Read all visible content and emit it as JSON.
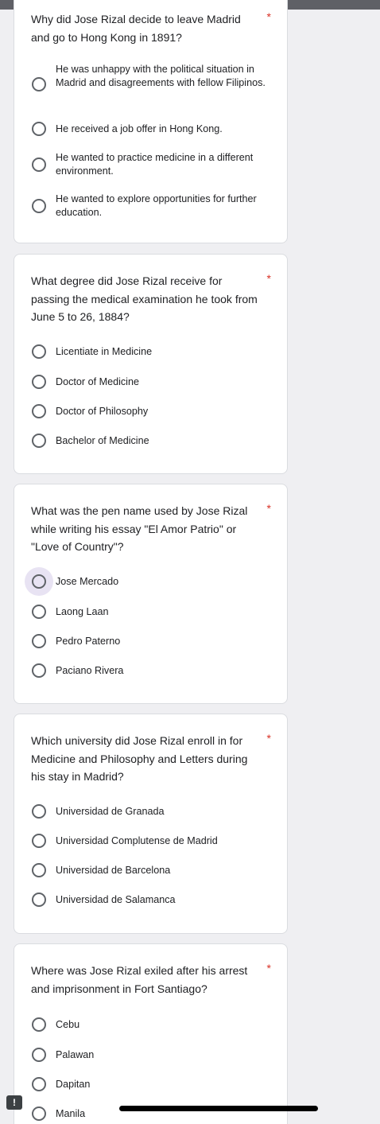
{
  "colors": {
    "required": "#d93025",
    "radio_border": "#5f6368",
    "background": "#efeff2"
  },
  "q1": {
    "title": "Why did Jose Rizal decide to leave Madrid and go to Hong Kong in 1891?",
    "required": "*",
    "options": [
      "He was unhappy with the political situation in Madrid and disagreements with fellow Filipinos.",
      "He received a job offer in Hong Kong.",
      "He wanted to practice medicine in a different environment.",
      "He wanted to explore opportunities for further education."
    ]
  },
  "q2": {
    "title": "What degree did Jose Rizal receive for passing the medical examination he took from June 5 to 26, 1884?",
    "required": "*",
    "options": [
      "Licentiate in Medicine",
      "Doctor of Medicine",
      "Doctor of Philosophy",
      "Bachelor of Medicine"
    ]
  },
  "q3": {
    "title": "What was the pen name used by Jose Rizal while writing his essay \"El Amor Patrio\" or \"Love of Country\"?",
    "required": "*",
    "options": [
      "Jose Mercado",
      "Laong Laan",
      "Pedro Paterno",
      "Paciano Rivera"
    ]
  },
  "q4": {
    "title": "Which university did Jose Rizal enroll in for Medicine and Philosophy and Letters during his stay in Madrid?",
    "required": "*",
    "options": [
      "Universidad de Granada",
      "Universidad Complutense de Madrid",
      "Universidad de Barcelona",
      "Universidad de Salamanca"
    ]
  },
  "q5": {
    "title": "Where was Jose Rizal exiled after his arrest and imprisonment in Fort Santiago?",
    "required": "*",
    "options": [
      "Cebu",
      "Palawan",
      "Dapitan",
      "Manila"
    ]
  },
  "report_icon": "!"
}
